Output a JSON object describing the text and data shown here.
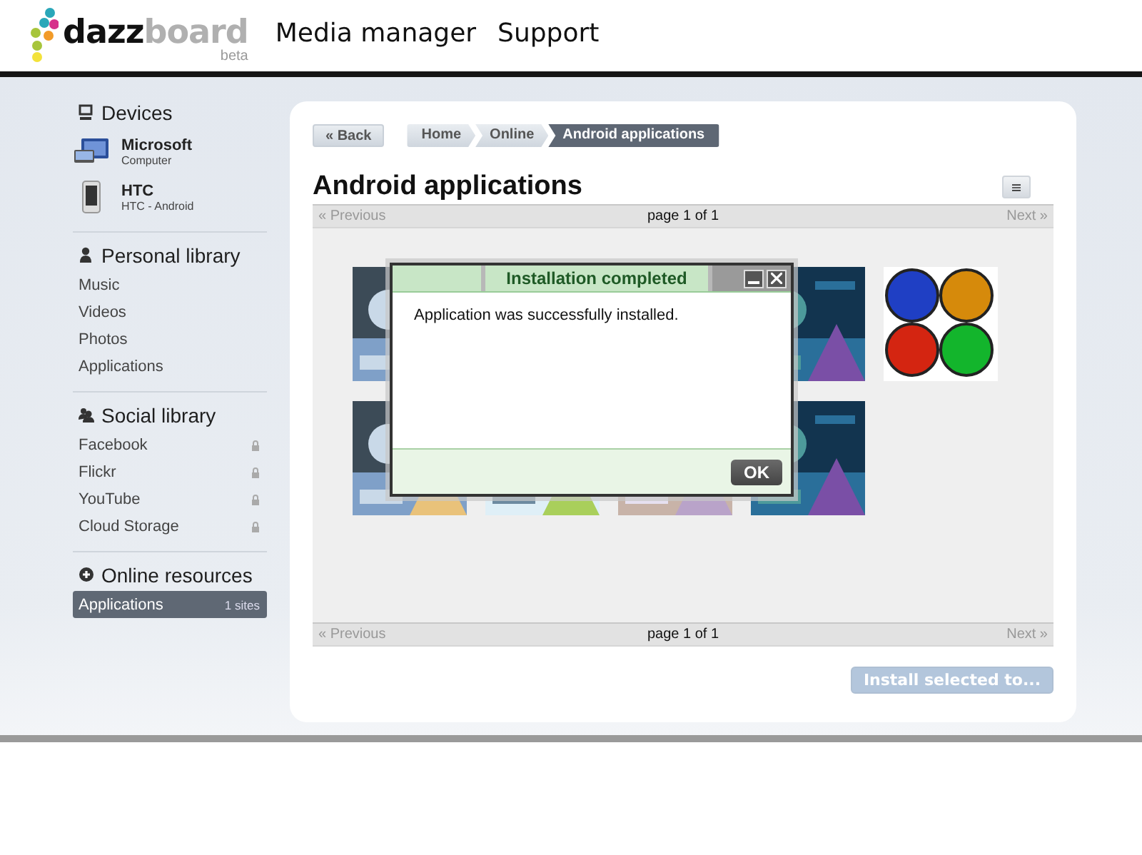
{
  "logo": {
    "bold": "dazz",
    "light": "board",
    "tag": "beta"
  },
  "nav": [
    "Media manager",
    "Support"
  ],
  "sidebar": [
    {
      "title": "Devices",
      "kind": "devices",
      "items": [
        {
          "kind": "computer",
          "name": "Microsoft",
          "detail": "Computer"
        },
        {
          "kind": "phone",
          "name": "HTC",
          "detail": "HTC - Android"
        }
      ]
    },
    {
      "title": "Personal library",
      "kind": "person",
      "items": [
        {
          "kind": "link",
          "label": "Music",
          "selected": false
        },
        {
          "kind": "link",
          "label": "Videos",
          "selected": false
        },
        {
          "kind": "link",
          "label": "Photos",
          "selected": false
        },
        {
          "kind": "link",
          "label": "Applications",
          "selected": false
        }
      ]
    },
    {
      "title": "Social library",
      "kind": "people",
      "items": [
        {
          "kind": "link",
          "label": "Facebook",
          "selected": false,
          "locked": true
        },
        {
          "kind": "link",
          "label": "Flickr",
          "selected": false,
          "locked": true
        },
        {
          "kind": "link",
          "label": "YouTube",
          "selected": false,
          "locked": true
        },
        {
          "kind": "link",
          "label": "Cloud Storage",
          "selected": false,
          "locked": true
        }
      ]
    },
    {
      "title": "Online resources",
      "kind": "plus",
      "items": [
        {
          "kind": "link",
          "label": "Applications",
          "count": "1 sites",
          "selected": true
        }
      ]
    }
  ],
  "main": {
    "back": "« Back",
    "breadcrumb": [
      {
        "label": "Home",
        "selected": false
      },
      {
        "label": "Online",
        "selected": false
      },
      {
        "label": "Android applications",
        "selected": true
      }
    ],
    "title": "Android applications",
    "pagers": [
      {
        "previous": "« Previous",
        "page": "page 1 of 1",
        "next": "Next »",
        "previous_disabled": true,
        "next_disabled": true
      },
      {
        "previous": "« Previous",
        "page": "page 1 of 1",
        "next": "Next »",
        "previous_disabled": true,
        "next_disabled": true
      }
    ],
    "tiles": [
      {
        "kind": "picture"
      },
      {
        "kind": "covered"
      },
      {
        "kind": "covered"
      },
      {
        "kind": "picture"
      },
      {
        "kind": "icon"
      },
      {
        "kind": "picture"
      },
      {
        "kind": "picture"
      },
      {
        "kind": "picture"
      },
      {
        "kind": "picture"
      }
    ],
    "install": {
      "label": "Install selected to...",
      "disabled": true
    }
  },
  "dialog": {
    "title": "Installation completed",
    "message": "Application was successfully installed.",
    "ok": "OK"
  }
}
